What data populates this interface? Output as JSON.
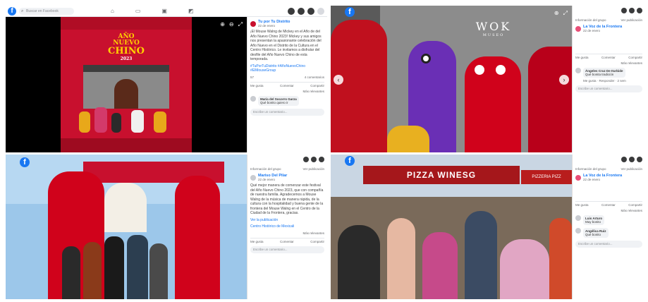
{
  "q1": {
    "search_placeholder": "Buscar en Facebook",
    "poster": {
      "title_line1": "AÑO",
      "title_line2": "NUEVO",
      "title_line3": "CHINO",
      "year": "2023"
    },
    "post": {
      "page_name": "Tu por Tu Distrito",
      "date": "22 de enero",
      "text": "¡El Mouse Walng de Mickey en el Año de del Año Nuevo Chino 2023! Mickey y sus amigos nos presentan la apasionante celebración del Año Nuevo en el Distrito de la Cultura en el Centro Histórico. Le invitamos a disfrutar del desfile del Año Nuevo Chino de esta temporada.",
      "hashtags": "#TuPorTuDistrito #AñoNuevoChino #ElMouseGroup",
      "reactions_count": "57",
      "comments_count": "4 comentarios",
      "like": "Me gusta",
      "comment": "Comentar",
      "share": "Compartir",
      "more_comments": "Más relevantes",
      "commenter": "María del Socorro Garza",
      "comment_text": "Qué bonito quiero ir",
      "input_placeholder": "Escribe un comentario..."
    }
  },
  "q2": {
    "store_sign": "WOK",
    "store_sub": "MUSEO",
    "side": {
      "group_label": "Información del grupo",
      "more_label": "Ver publicación",
      "page_name": "La Voz de la Frontera",
      "meta": "22 de enero",
      "like": "Me gusta",
      "comment": "Comentar",
      "share": "Compartir",
      "sort": "Más relevantes",
      "commenter": "Ángeles Cruz De Iturbide",
      "comment_text": "Qué bonita tradición",
      "reply_meta": "Me gusta · Responder · 2 sem",
      "input_placeholder": "Escribe un comentario..."
    }
  },
  "q3": {
    "post": {
      "header": "Información del grupo",
      "more": "Ver publicación",
      "page_name": "Mariso Del Pilar",
      "date": "22 de enero",
      "text": "Qué mejor manera de comenzar este festival del Año Nuevo Chino 2023, que con compañía de nuestra familia. Agradecemos a Mouse Walng de la música de manera rápida, de la cultura con la hospitalidad y buena gente de la frontera del Mouse Walng en el Centro de la Ciudad de la Frontera, gracias.",
      "link": "Ver la publicación",
      "location": "Centro Histórico de Mexicali",
      "more_comments": "Más relevantes",
      "like": "Me gusta",
      "comment": "Comentar",
      "share": "Compartir",
      "input_placeholder": "Escribe un comentario..."
    }
  },
  "q4": {
    "banner": "PIZZA WINESG",
    "side_banner": "PIZZERIA PIZZ",
    "side": {
      "group_label": "Información del grupo",
      "more_label": "Ver publicación",
      "page_name": "La Voz de la Frontera",
      "meta": "22 de enero",
      "like": "Me gusta",
      "comment": "Comentar",
      "share": "Compartir",
      "sort": "Más relevantes",
      "commenter1": "Luis Arturo",
      "comment1": "Muy bonito",
      "commenter2": "Angélica Ruiz",
      "comment2": "Qué bonito",
      "input_placeholder": "Escribe un comentario..."
    }
  },
  "colors": {
    "facebook_blue": "#1877f2",
    "poster_red": "#c8102e",
    "lion_red": "#d0021b",
    "background": "#ffffff"
  }
}
